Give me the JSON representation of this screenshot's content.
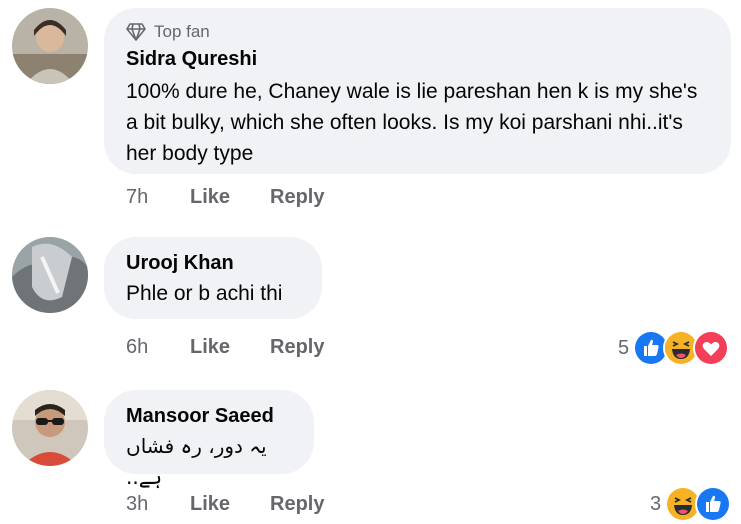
{
  "comments": [
    {
      "badge": "Top fan",
      "author": "Sidra Qureshi",
      "text": "100% dure he, Chaney wale is lie pareshan hen k is my she's a bit bulky, which she often looks. Is my koi parshani nhi..it's her body type",
      "time": "7h",
      "like": "Like",
      "reply": "Reply",
      "reaction_count": "",
      "reactions": []
    },
    {
      "badge": "",
      "author": "Urooj Khan",
      "text": "Phle or b achi thi",
      "time": "6h",
      "like": "Like",
      "reply": "Reply",
      "reaction_count": "5",
      "reactions": [
        "like-reaction-icon",
        "haha-reaction-icon",
        "love-reaction-icon"
      ]
    },
    {
      "badge": "",
      "author": "Mansoor Saeed",
      "text": "یہ دور، رہ فشاں ہے..",
      "time": "3h",
      "like": "Like",
      "reply": "Reply",
      "reaction_count": "3",
      "reactions": [
        "haha-reaction-icon",
        "like-reaction-icon"
      ]
    }
  ],
  "colors": {
    "bubble": "#f0f2f5",
    "meta": "#65676b",
    "like_blue": "#1877f2",
    "haha_yellow": "#f7b125",
    "love_red": "#f33e58"
  }
}
